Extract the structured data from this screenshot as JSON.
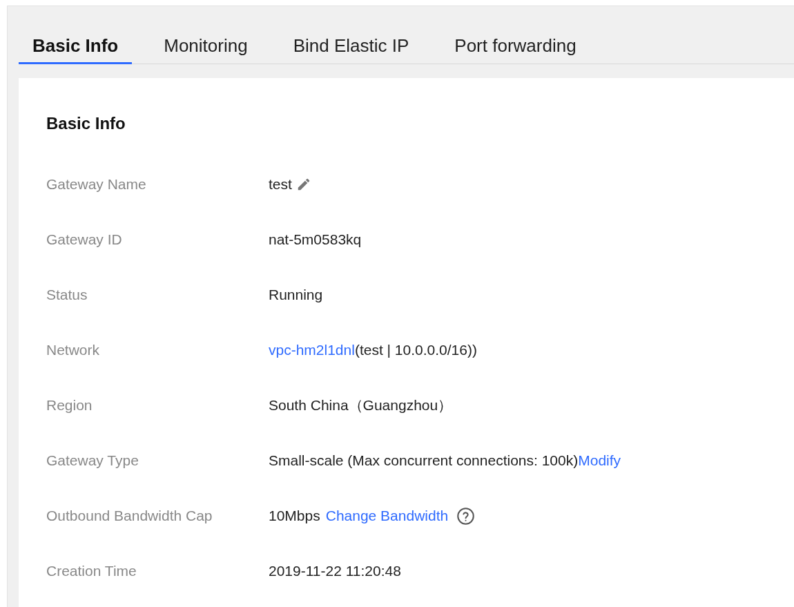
{
  "tabs": [
    {
      "label": "Basic Info",
      "selected": true
    },
    {
      "label": "Monitoring",
      "selected": false
    },
    {
      "label": "Bind Elastic IP",
      "selected": false
    },
    {
      "label": "Port forwarding",
      "selected": false
    }
  ],
  "section": {
    "title": "Basic Info",
    "rows": [
      {
        "label": "Gateway Name",
        "parts": [
          {
            "kind": "text",
            "text": "test"
          },
          {
            "kind": "edit"
          }
        ]
      },
      {
        "label": "Gateway ID",
        "parts": [
          {
            "kind": "text",
            "text": "nat-5m0583kq"
          }
        ]
      },
      {
        "label": "Status",
        "parts": [
          {
            "kind": "text",
            "text": "Running"
          }
        ]
      },
      {
        "label": "Network",
        "parts": [
          {
            "kind": "link",
            "text": "vpc-hm2l1dnl"
          },
          {
            "kind": "text",
            "text": "(test | 10.0.0.0/16))"
          }
        ]
      },
      {
        "label": "Region",
        "parts": [
          {
            "kind": "text",
            "text": "South China（Guangzhou）"
          }
        ]
      },
      {
        "label": "Gateway Type",
        "parts": [
          {
            "kind": "text",
            "text": "Small-scale (Max concurrent connections: 100k)"
          },
          {
            "kind": "link",
            "text": "Modify"
          }
        ]
      },
      {
        "label": "Outbound Bandwidth Cap",
        "parts": [
          {
            "kind": "text",
            "text": "10Mbps"
          },
          {
            "kind": "spaced_link",
            "text": "Change Bandwidth"
          },
          {
            "kind": "help"
          }
        ]
      },
      {
        "label": "Creation Time",
        "parts": [
          {
            "kind": "text",
            "text": "2019-11-22 11:20:48"
          }
        ]
      }
    ]
  }
}
